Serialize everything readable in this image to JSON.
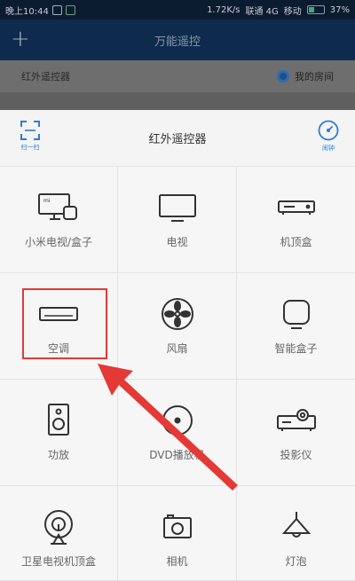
{
  "status_bar": {
    "time": "晚上10:44",
    "speed": "1.72K/s",
    "carrier1": "联通 4G",
    "carrier2": "移动",
    "battery": "37%"
  },
  "background_app": {
    "title": "万能遥控",
    "add_label": "+",
    "sub_title": "红外遥控器",
    "room_label": "我的房间"
  },
  "sheet": {
    "title": "红外遥控器",
    "scan_label": "扫一扫",
    "timer_label": "闹钟"
  },
  "devices": [
    {
      "label": "小米电视/盒子",
      "icon": "mi-tv-box-icon"
    },
    {
      "label": "电视",
      "icon": "tv-icon"
    },
    {
      "label": "机顶盒",
      "icon": "set-top-box-icon"
    },
    {
      "label": "空调",
      "icon": "air-conditioner-icon"
    },
    {
      "label": "风扇",
      "icon": "fan-icon"
    },
    {
      "label": "智能盒子",
      "icon": "smart-box-icon"
    },
    {
      "label": "功放",
      "icon": "speaker-icon"
    },
    {
      "label": "DVD播放机",
      "icon": "dvd-icon"
    },
    {
      "label": "投影仪",
      "icon": "projector-icon"
    },
    {
      "label": "卫星电视机顶盒",
      "icon": "satellite-icon"
    },
    {
      "label": "相机",
      "icon": "camera-icon"
    },
    {
      "label": "灯泡",
      "icon": "lamp-icon"
    }
  ],
  "colors": {
    "accent": "#2b7ed6",
    "highlight": "#e53935",
    "icon": "#333333"
  }
}
